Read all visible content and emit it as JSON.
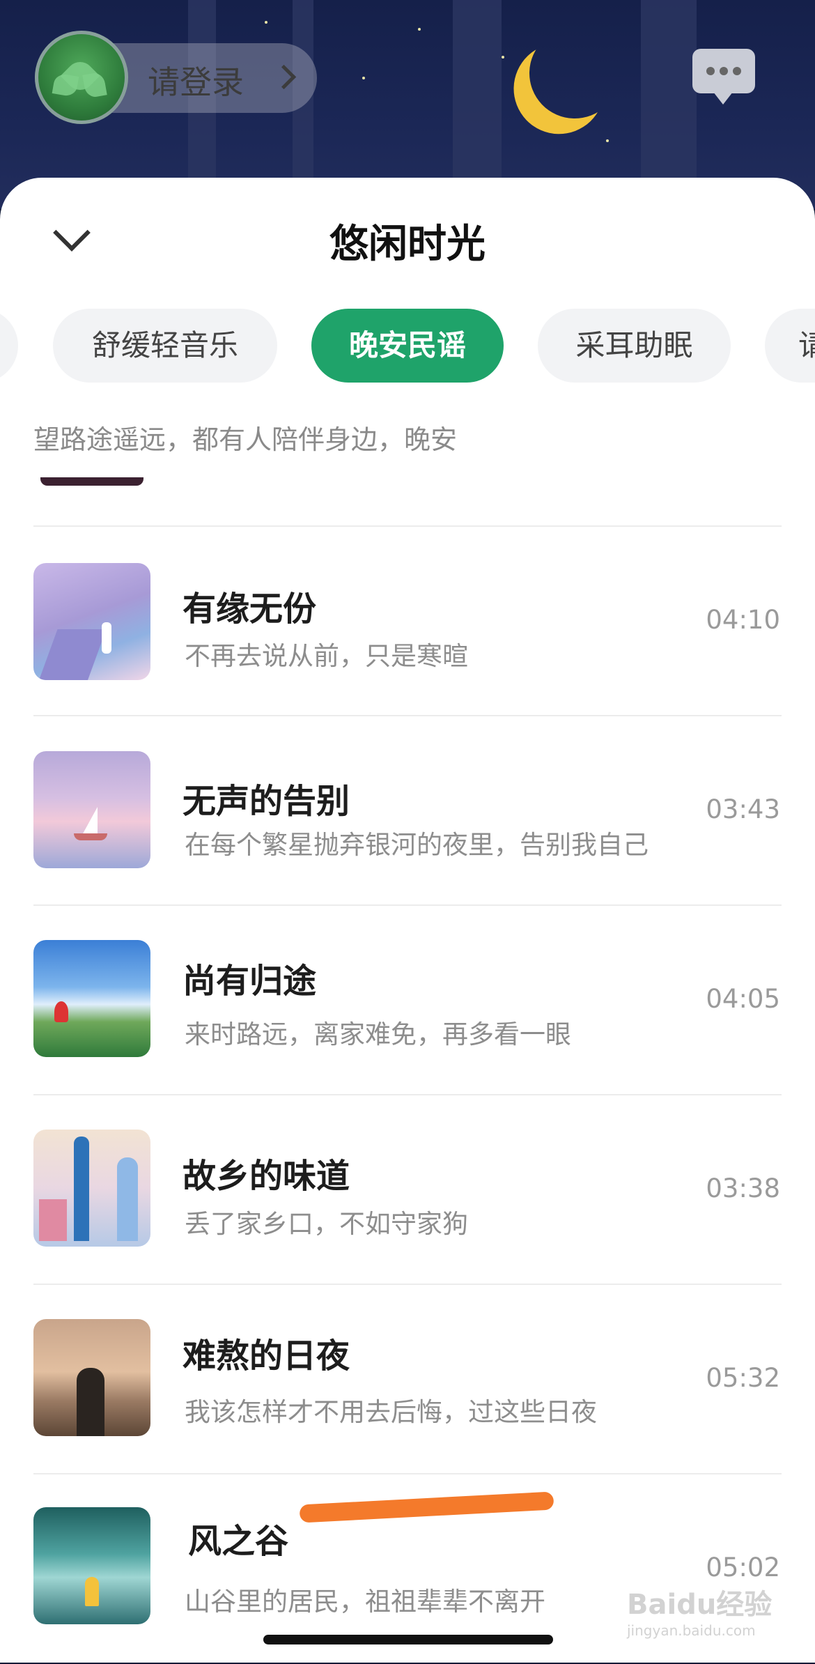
{
  "header": {
    "login_label": "请登录"
  },
  "sheet": {
    "title": "悠闲时光",
    "tabs": [
      {
        "label": "舒缓轻音乐",
        "active": false
      },
      {
        "label": "晚安民谣",
        "active": true
      },
      {
        "label": "采耳助眠",
        "active": false
      },
      {
        "label": "请",
        "active": false
      }
    ],
    "subtitle": "望路途遥远，都有人陪伴身边，晚安"
  },
  "songs": [
    {
      "title": "有缘无份",
      "desc": "不再去说从前，只是寒暄",
      "duration": "04:10",
      "thumb": "railway-bridge-dusk"
    },
    {
      "title": "无声的告别",
      "desc": "在每个繁星抛弃银河的夜里，告别我自己",
      "duration": "03:43",
      "thumb": "sailboat-pink-sea"
    },
    {
      "title": "尚有归途",
      "desc": "来时路远，离家难免，再多看一眼",
      "duration": "04:05",
      "thumb": "girl-on-hill"
    },
    {
      "title": "故乡的味道",
      "desc": "丢了家乡口，不如守家狗",
      "duration": "03:38",
      "thumb": "city-skyline"
    },
    {
      "title": "难熬的日夜",
      "desc": "我该怎样才不用去后悔，过这些日夜",
      "duration": "05:32",
      "thumb": "man-arms-raised-sunset"
    },
    {
      "title": "风之谷",
      "desc": "山谷里的居民，祖祖辈辈不离开",
      "duration": "05:02",
      "thumb": "forest-valley-figure"
    }
  ],
  "watermark": {
    "brand": "Baidu经验",
    "url": "jingyan.baidu.com"
  },
  "colors": {
    "accent": "#1fa36a",
    "annotation": "#f47a2b"
  }
}
